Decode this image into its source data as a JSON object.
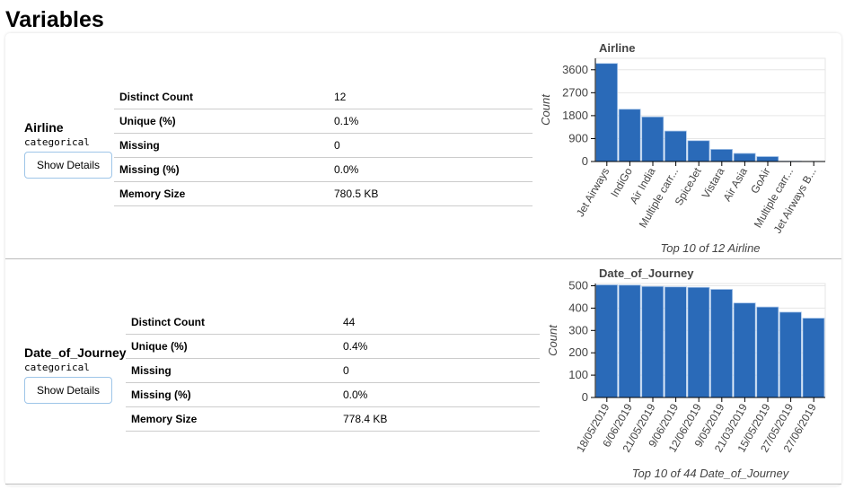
{
  "page_title": "Variables",
  "variables": [
    {
      "name": "Airline",
      "type": "categorical",
      "button": "Show Details",
      "stats": [
        {
          "label": "Distinct Count",
          "value": "12"
        },
        {
          "label": "Unique (%)",
          "value": "0.1%"
        },
        {
          "label": "Missing",
          "value": "0"
        },
        {
          "label": "Missing (%)",
          "value": "0.0%"
        },
        {
          "label": "Memory Size",
          "value": "780.5 KB"
        }
      ]
    },
    {
      "name": "Date_of_Journey",
      "type": "categorical",
      "button": "Show Details",
      "stats": [
        {
          "label": "Distinct Count",
          "value": "44"
        },
        {
          "label": "Unique (%)",
          "value": "0.4%"
        },
        {
          "label": "Missing",
          "value": "0"
        },
        {
          "label": "Missing (%)",
          "value": "0.0%"
        },
        {
          "label": "Memory Size",
          "value": "778.4 KB"
        }
      ]
    }
  ],
  "chart_data": [
    {
      "type": "bar",
      "title": "Airline",
      "xlabel": "Top 10 of 12 Airline",
      "ylabel": "Count",
      "categories": [
        "Jet Airways",
        "IndiGo",
        "Air India",
        "Multiple carr...",
        "SpiceJet",
        "Vistara",
        "Air Asia",
        "GoAir",
        "Multiple carr...",
        "Jet Airways B..."
      ],
      "values": [
        3849,
        2053,
        1752,
        1196,
        818,
        479,
        319,
        194,
        13,
        6
      ],
      "yticks": [
        0,
        900,
        1800,
        2700,
        3600
      ],
      "ylim": [
        0,
        4050
      ],
      "grid": true,
      "bar_color": "#2a6ab8"
    },
    {
      "type": "bar",
      "title": "Date_of_Journey",
      "xlabel": "Top 10 of 44 Date_of_Journey",
      "ylabel": "Count",
      "categories": [
        "18/05/2019",
        "6/06/2019",
        "21/05/2019",
        "9/06/2019",
        "12/06/2019",
        "9/05/2019",
        "21/03/2019",
        "15/05/2019",
        "27/05/2019",
        "27/06/2019"
      ],
      "values": [
        504,
        503,
        497,
        495,
        493,
        484,
        423,
        405,
        382,
        355
      ],
      "yticks": [
        0,
        100,
        200,
        300,
        400,
        500
      ],
      "ylim": [
        0,
        510
      ],
      "grid": true,
      "bar_color": "#2a6ab8"
    }
  ]
}
